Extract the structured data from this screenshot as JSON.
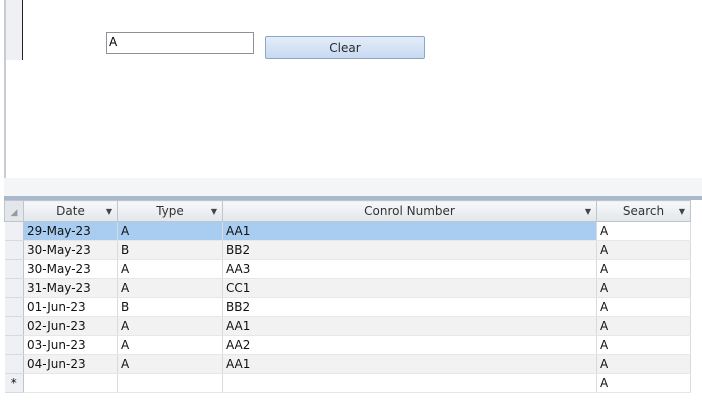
{
  "form": {
    "search_value": "A",
    "clear_label": "Clear"
  },
  "datasheet": {
    "columns": [
      "Date",
      "Type",
      "Conrol Number",
      "Search"
    ],
    "rows": [
      {
        "date": "29-May-23",
        "type": "A",
        "control_number": "AA1",
        "search": "A"
      },
      {
        "date": "30-May-23",
        "type": "B",
        "control_number": "BB2",
        "search": "A"
      },
      {
        "date": "30-May-23",
        "type": "A",
        "control_number": "AA3",
        "search": "A"
      },
      {
        "date": "31-May-23",
        "type": "A",
        "control_number": "CC1",
        "search": "A"
      },
      {
        "date": "01-Jun-23",
        "type": "B",
        "control_number": "BB2",
        "search": "A"
      },
      {
        "date": "02-Jun-23",
        "type": "A",
        "control_number": "AA1",
        "search": "A"
      },
      {
        "date": "03-Jun-23",
        "type": "A",
        "control_number": "AA2",
        "search": "A"
      },
      {
        "date": "04-Jun-23",
        "type": "A",
        "control_number": "AA1",
        "search": "A"
      }
    ],
    "new_row": {
      "marker": "*",
      "search": "A"
    }
  }
}
